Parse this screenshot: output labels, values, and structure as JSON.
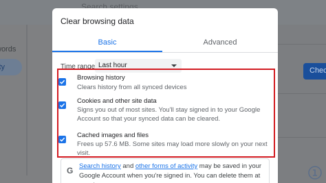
{
  "background": {
    "search_placeholder": "Search settings",
    "sidebar_item_1": "words",
    "sidebar_item_2": "ity",
    "button_label": "Check"
  },
  "dialog": {
    "title": "Clear browsing data",
    "tabs": [
      {
        "label": "Basic",
        "selected": true
      },
      {
        "label": "Advanced",
        "selected": false
      }
    ],
    "time_range": {
      "label": "Time range",
      "value": "Last hour"
    },
    "options": [
      {
        "title": "Browsing history",
        "description": "Clears history from all synced devices",
        "checked": true
      },
      {
        "title": "Cookies and other site data",
        "description": "Signs you out of most sites. You'll stay signed in to your Google Account so that your synced data can be cleared.",
        "checked": true
      },
      {
        "title": "Cached images and files",
        "description": "Frees up 57.6 MB. Some sites may load more slowly on your next visit.",
        "checked": true
      }
    ],
    "info": {
      "icon": "google-g-icon",
      "link1": "Search history",
      "text1": " and ",
      "link2": "other forms of activity",
      "text2": " may be saved in your Google Account when you're signed in. You can delete them at any time."
    }
  },
  "colors": {
    "accent": "#1a73e8",
    "highlight": "#d21a20"
  }
}
